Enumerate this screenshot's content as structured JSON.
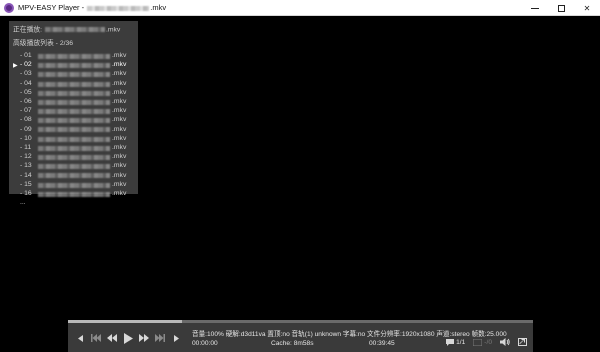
{
  "window": {
    "title_prefix": "MPV-EASY Player -",
    "title_suffix": ".mkv",
    "controls": {
      "minimize": "—",
      "maximize": "□",
      "close": "✕"
    }
  },
  "playlist": {
    "now_playing_label": "正在播放:",
    "now_playing_ext": ".mkv",
    "header": "高级播放列表 - 2/36",
    "current_marker": "▶",
    "items": [
      {
        "num": "- 01",
        "ext": ".mkv",
        "current": false
      },
      {
        "num": "- 02",
        "ext": ".mkv",
        "current": true
      },
      {
        "num": "- 03",
        "ext": ".mkv",
        "current": false
      },
      {
        "num": "- 04",
        "ext": ".mkv",
        "current": false
      },
      {
        "num": "- 05",
        "ext": ".mkv",
        "current": false
      },
      {
        "num": "- 06",
        "ext": ".mkv",
        "current": false
      },
      {
        "num": "- 07",
        "ext": ".mkv",
        "current": false
      },
      {
        "num": "- 08",
        "ext": ".mkv",
        "current": false
      },
      {
        "num": "- 09",
        "ext": ".mkv",
        "current": false
      },
      {
        "num": "- 10",
        "ext": ".mkv",
        "current": false
      },
      {
        "num": "- 11",
        "ext": ".mkv",
        "current": false
      },
      {
        "num": "- 12",
        "ext": ".mkv",
        "current": false
      },
      {
        "num": "- 13",
        "ext": ".mkv",
        "current": false
      },
      {
        "num": "- 14",
        "ext": ".mkv",
        "current": false
      },
      {
        "num": "- 15",
        "ext": ".mkv",
        "current": false
      },
      {
        "num": "- 16",
        "ext": ".mkv",
        "current": false
      }
    ],
    "more": "..."
  },
  "player": {
    "progress_fraction": 0.245,
    "info_line": "音量:100%  硬解:d3d11va  置顶:no  音轨(1) unknown  字幕:no  文件分辨率:1920x1080  声道:stereo  帧数:25.000",
    "time_current": "00:00:00",
    "cache": "Cache: 8m58s",
    "time_total": "00:39:45",
    "subtitle_count": "1/1",
    "audio_track": "-/0"
  }
}
